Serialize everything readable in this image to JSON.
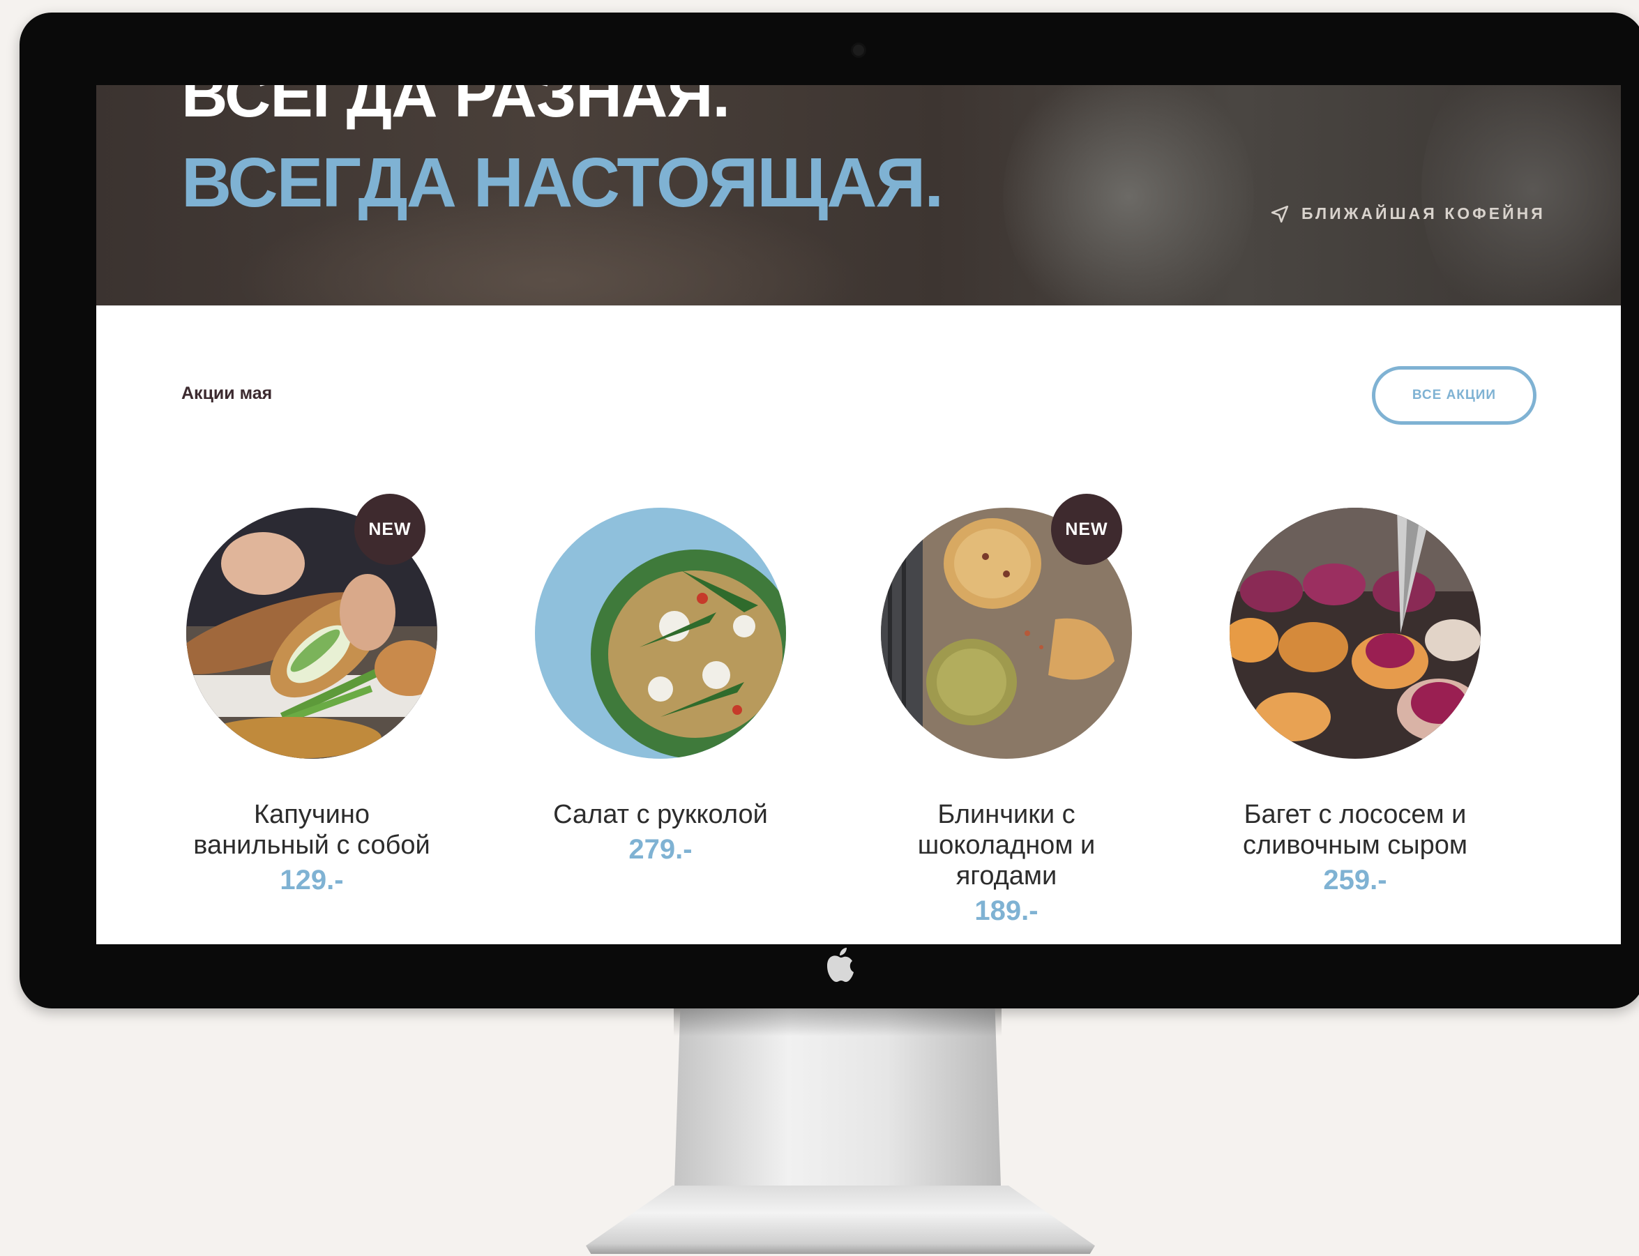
{
  "hero": {
    "line1": "ВСЕГДА РАЗНАЯ.",
    "line2": "ВСЕГДА НАСТОЯЩАЯ.",
    "nearest_label": "БЛИЖАЙШАЯ КОФЕЙНЯ",
    "nearest_icon": "location-arrow-icon"
  },
  "promos": {
    "title": "Акции мая",
    "all_button": "ВСЕ АКЦИИ"
  },
  "items": [
    {
      "name_l1": "Капучино",
      "name_l2": "ванильный с собой",
      "name_l3": "",
      "price": "129.-",
      "badge": "NEW"
    },
    {
      "name_l1": "Салат с рукколой",
      "name_l2": "",
      "name_l3": "",
      "price": "279.-",
      "badge": ""
    },
    {
      "name_l1": "Блинчики с",
      "name_l2": "шоколадном и",
      "name_l3": "ягодами",
      "price": "189.-",
      "badge": "NEW"
    },
    {
      "name_l1": "Багет с лососем и",
      "name_l2": "сливочным сыром",
      "name_l3": "",
      "price": "259.-",
      "badge": ""
    }
  ],
  "colors": {
    "accent": "#7fb2d3",
    "badge": "#3e2a2e",
    "hero_bg": "#3b3330"
  }
}
